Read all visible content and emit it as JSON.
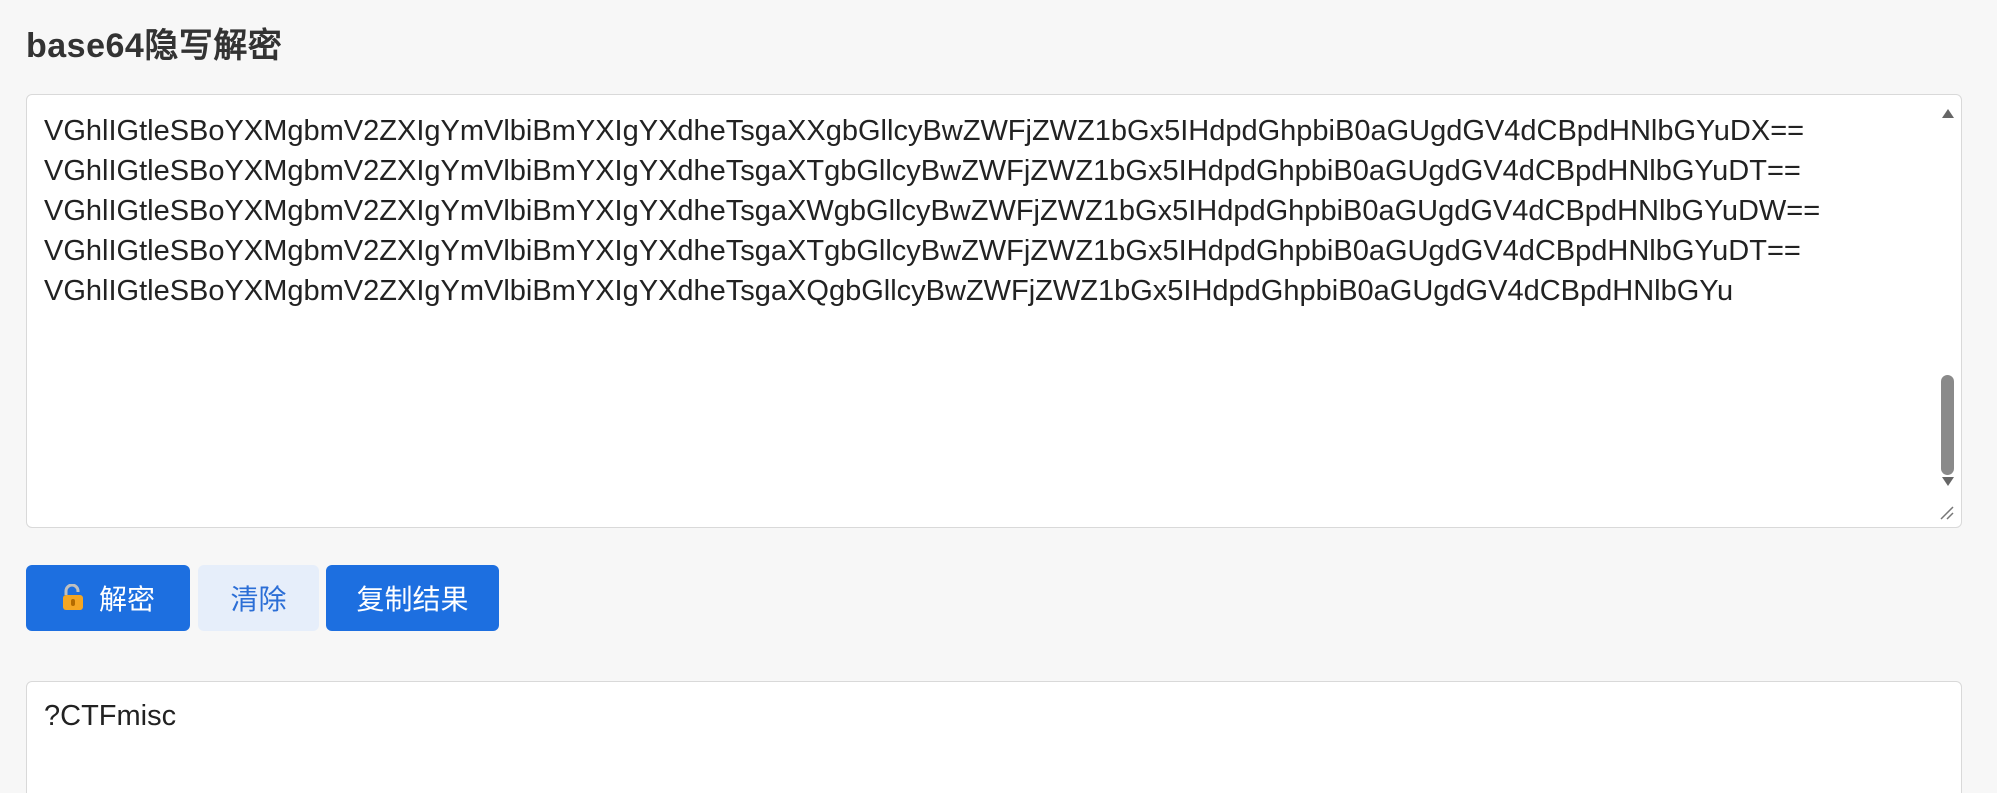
{
  "page": {
    "title": "base64隐写解密"
  },
  "input": {
    "value": "VGhlIGtleSBoYXMgbmV2ZXIgYmVlbiBmYXIgYXdheTsgaXXgbGllcyBwZWFjZWZ1bGx5IHdpdGhpbiB0aGUgdGV4dCBpdHNlbGYuDX==\nVGhlIGtleSBoYXMgbmV2ZXIgYmVlbiBmYXIgYXdheTsgaXTgbGllcyBwZWFjZWZ1bGx5IHdpdGhpbiB0aGUgdGV4dCBpdHNlbGYuDT==\nVGhlIGtleSBoYXMgbmV2ZXIgYmVlbiBmYXIgYXdheTsgaXWgbGllcyBwZWFjZWZ1bGx5IHdpdGhpbiB0aGUgdGV4dCBpdHNlbGYuDW==\nVGhlIGtleSBoYXMgbmV2ZXIgYmVlbiBmYXIgYXdheTsgaXTgbGllcyBwZWFjZWZ1bGx5IHdpdGhpbiB0aGUgdGV4dCBpdHNlbGYuDT==\nVGhlIGtleSBoYXMgbmV2ZXIgYmVlbiBmYXIgYXdheTsgaXQgbGllcyBwZWFjZWZ1bGx5IHdpdGhpbiB0aGUgdGV4dCBpdHNlbGYu"
  },
  "buttons": {
    "decrypt_label": "解密",
    "clear_label": "清除",
    "copy_label": "复制结果"
  },
  "icons": {
    "decrypt": "unlock-icon"
  },
  "output": {
    "value": "?CTFmisc"
  },
  "colors": {
    "primary": "#1d6fe0",
    "light_button": "#e6eefa",
    "light_button_text": "#2b6ed6",
    "background": "#f7f7f7"
  }
}
